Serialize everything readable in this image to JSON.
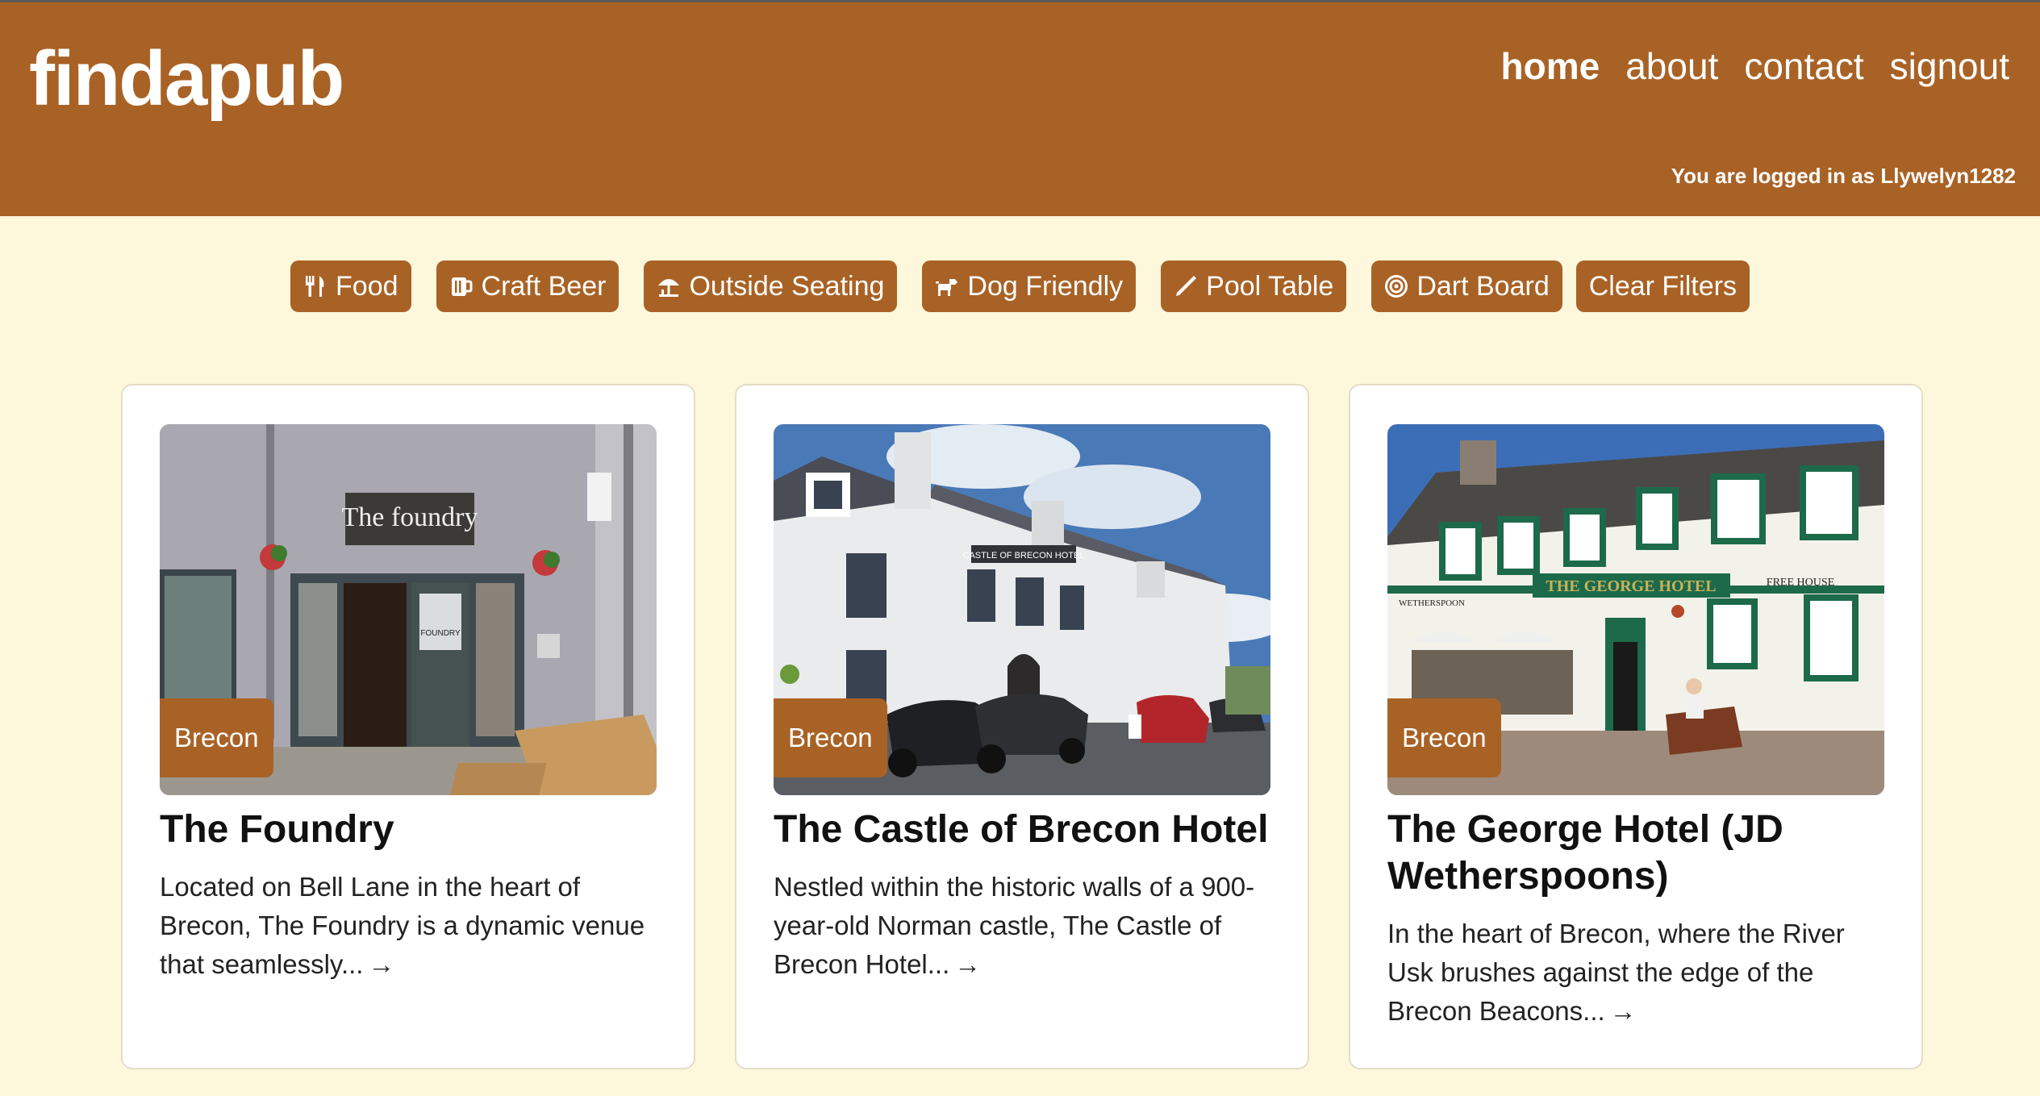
{
  "header": {
    "logo": "findapub",
    "nav": [
      {
        "label": "home",
        "active": true
      },
      {
        "label": "about",
        "active": false
      },
      {
        "label": "contact",
        "active": false
      },
      {
        "label": "signout",
        "active": false
      }
    ],
    "login_text": "You are logged in as Llywelyn1282"
  },
  "filters": [
    {
      "label": "Food",
      "icon": "utensils-icon"
    },
    {
      "label": "Craft Beer",
      "icon": "beer-mug-icon"
    },
    {
      "label": "Outside Seating",
      "icon": "umbrella-table-icon"
    },
    {
      "label": "Dog Friendly",
      "icon": "dog-icon"
    },
    {
      "label": "Pool Table",
      "icon": "cue-icon"
    },
    {
      "label": "Dart Board",
      "icon": "target-icon"
    },
    {
      "label": "Clear Filters",
      "icon": ""
    }
  ],
  "cards": [
    {
      "location": "Brecon",
      "title": "The Foundry",
      "description": "Located on Bell Lane in the heart of Brecon, The Foundry is a dynamic venue that seamlessly...",
      "sign_text": "The foundry",
      "door_text": "FOUNDRY"
    },
    {
      "location": "Brecon",
      "title": "The Castle of Brecon Hotel",
      "description": "Nestled within the historic walls of a 900-year-old Norman castle, The Castle of Brecon Hotel...",
      "sign_text": "CASTLE OF BRECON HOTEL"
    },
    {
      "location": "Brecon",
      "title": "The George Hotel (JD Wetherspoons)",
      "description": "In the heart of Brecon, where the River Usk brushes against the edge of the Brecon Beacons...",
      "sign_text": "THE GEORGE HOTEL",
      "sign_left": "WETHERSPOON",
      "sign_right": "FREE HOUSE"
    }
  ],
  "arrow_icon": "arrow-right-icon",
  "colors": {
    "brand": "#a96225",
    "background": "#fdf7dc"
  }
}
